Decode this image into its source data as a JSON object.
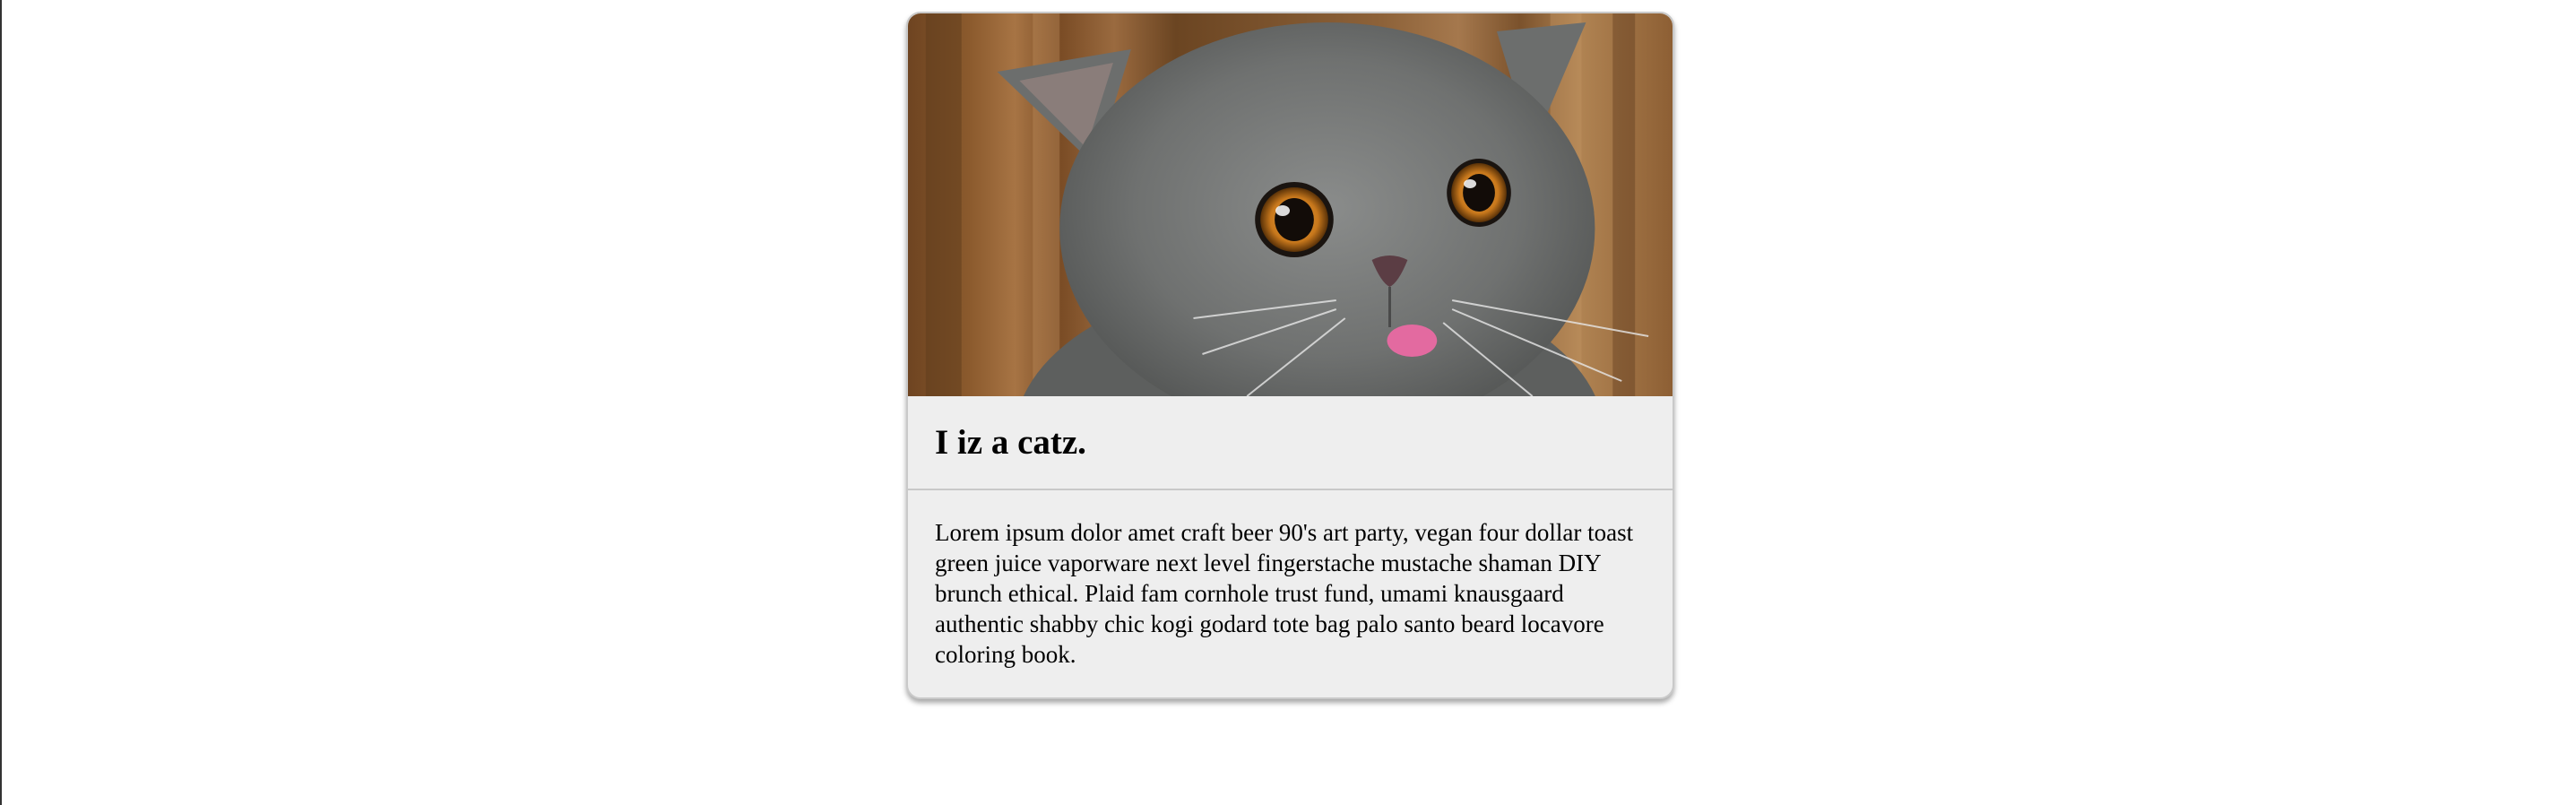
{
  "card": {
    "image_subject": "cat-photo",
    "title": "I iz a catz.",
    "body": "Lorem ipsum dolor amet craft beer 90's art party, vegan four dollar toast green juice vaporware next level fingerstache mustache shaman DIY brunch ethical. Plaid fam cornhole trust fund, umami knausgaard authentic shabby chic kogi godard tote bag palo santo beard locavore coloring book."
  },
  "colors": {
    "card_background": "#eeeeee",
    "divider": "#c8c8c8",
    "page_background": "#ffffff"
  }
}
